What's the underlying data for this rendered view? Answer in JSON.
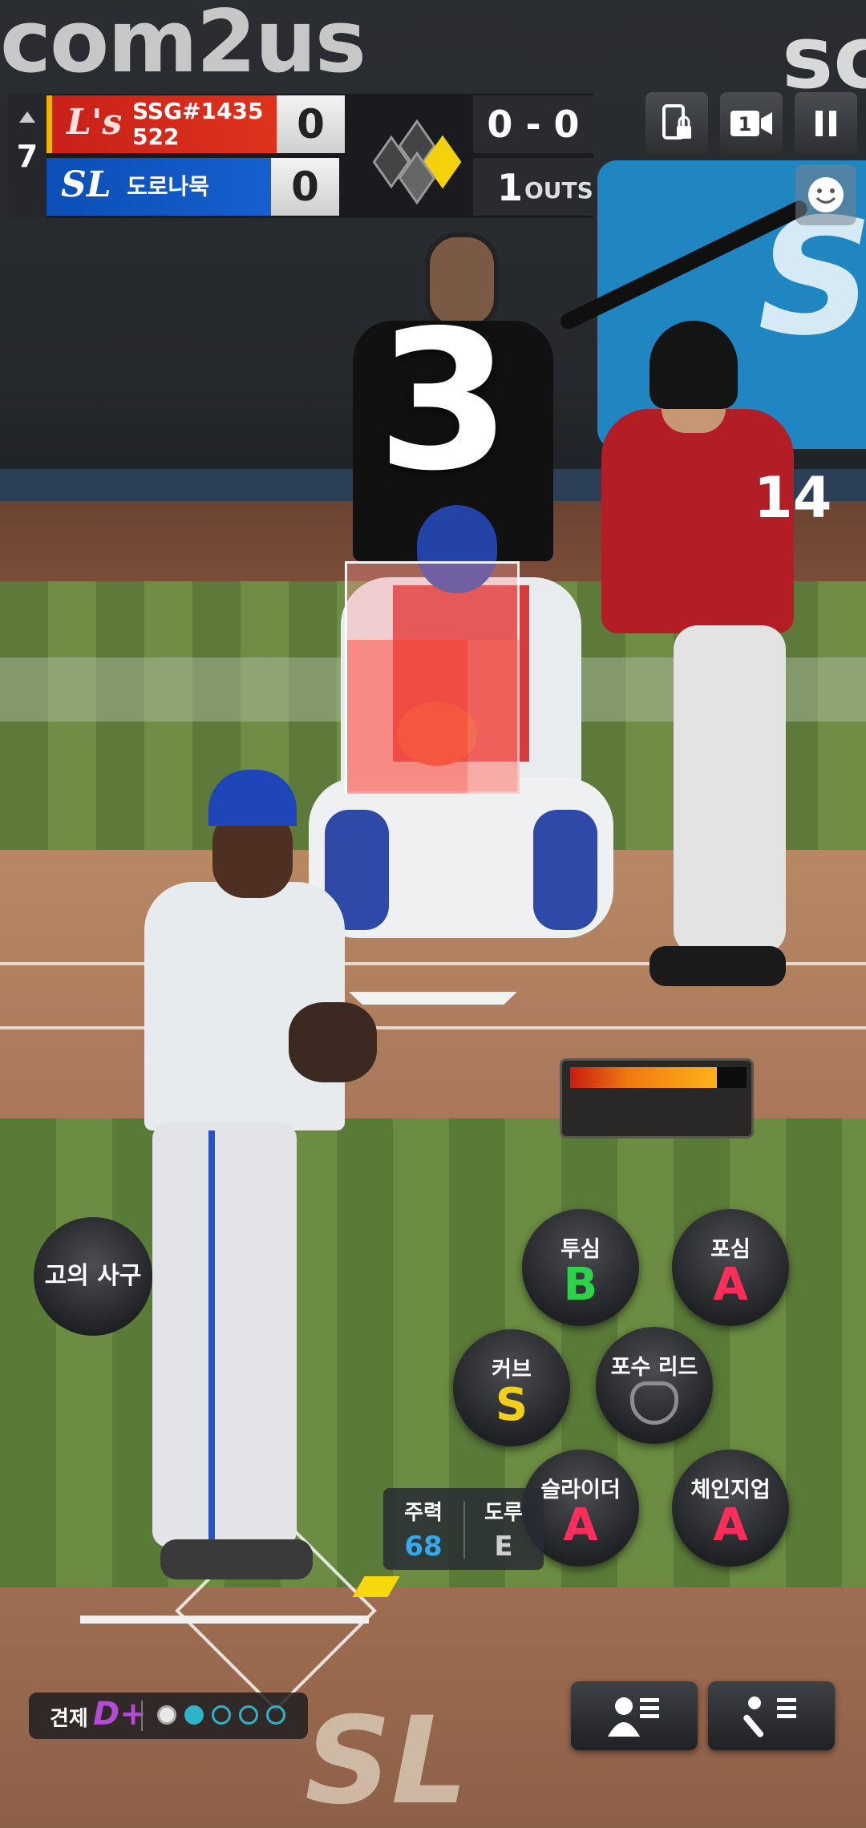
{
  "background": {
    "brand_top": "com2us",
    "brand_top_right": "sc",
    "banner_logo": "S",
    "field_logo": "SL"
  },
  "scoreboard": {
    "inning": "7",
    "inning_half": "top",
    "away": {
      "logo": "L's",
      "name": "SSG#1435 522",
      "score": "0",
      "color": "#d6281a"
    },
    "home": {
      "logo": "SL",
      "name": "도로나묵",
      "score": "0",
      "color": "#1258c6"
    },
    "count": "0 - 0",
    "outs": "1",
    "outs_label": "OUTS",
    "runners": {
      "first": true,
      "second": false,
      "third": false
    }
  },
  "top_buttons": {
    "lock_icon": "phone-lock-icon",
    "camera_icon": "camera-1-icon",
    "pause_icon": "pause-icon",
    "emote_icon": "smile-icon"
  },
  "batter": {
    "number": "14"
  },
  "overlay": {
    "countdown": "3"
  },
  "power_gauge": {
    "level": 0.83
  },
  "intent_walk": {
    "label": "고의 사구"
  },
  "pitches": [
    {
      "label": "투심",
      "grade": "B",
      "color": "#2fd34a"
    },
    {
      "label": "포심",
      "grade": "A",
      "color": "#ff2d5a"
    },
    {
      "label": "커브",
      "grade": "S",
      "color": "#f2cf1a"
    },
    {
      "label": "슬라이더",
      "grade": "A",
      "color": "#ff2d5a"
    },
    {
      "label": "체인지업",
      "grade": "A",
      "color": "#ff2d5a"
    }
  ],
  "catcher_lead": {
    "label": "포수 리드"
  },
  "runner_panel": {
    "speed_label": "주력",
    "speed_value": "68",
    "steal_label": "도루",
    "steal_value": "E"
  },
  "pickoff": {
    "label": "견제",
    "grade": "D+",
    "used": 1,
    "current": 1,
    "total": 5
  },
  "bottom_buttons": {
    "lineup_icon": "player-list-icon",
    "batting_icon": "bat-ball-list-icon"
  }
}
